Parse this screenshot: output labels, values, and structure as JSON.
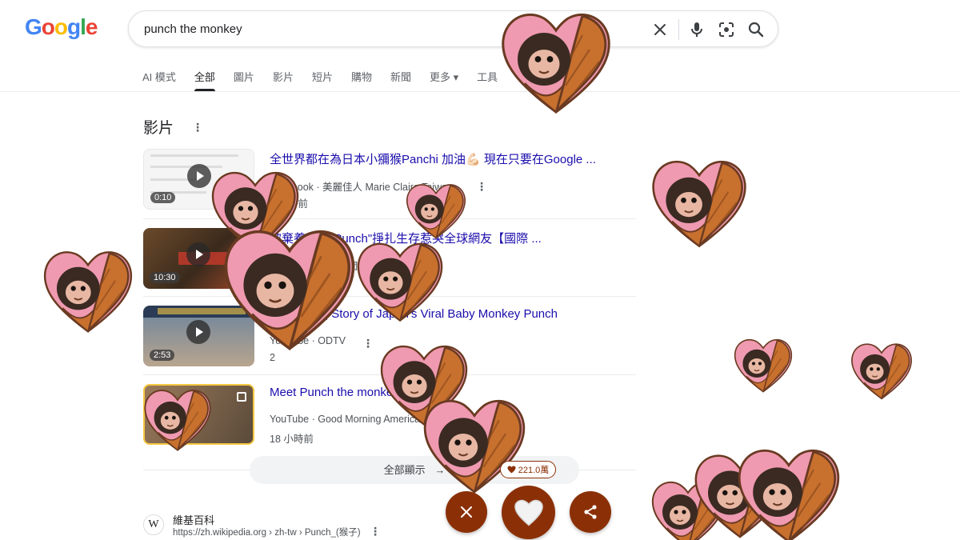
{
  "logo": {
    "letters": [
      "G",
      "o",
      "o",
      "g",
      "l",
      "e"
    ],
    "colors": [
      "#4285F4",
      "#EA4335",
      "#FBBC05",
      "#4285F4",
      "#34A853",
      "#EA4335"
    ]
  },
  "search": {
    "query": "punch the monkey",
    "icons": [
      "close-icon",
      "mic-icon",
      "lens-icon",
      "search-icon"
    ]
  },
  "tabs": [
    {
      "label": "AI 模式",
      "active": false
    },
    {
      "label": "全部",
      "active": true
    },
    {
      "label": "圖片",
      "active": false
    },
    {
      "label": "影片",
      "active": false
    },
    {
      "label": "短片",
      "active": false
    },
    {
      "label": "購物",
      "active": false
    },
    {
      "label": "新聞",
      "active": false
    },
    {
      "label": "更多 ▾",
      "active": false
    },
    {
      "label": "工具",
      "active": false
    }
  ],
  "videos_section": {
    "title": "影片",
    "items": [
      {
        "title": "全世界都在為日本小獼猴Panchi 加油💪🏻 現在只要在Google ...",
        "meta": "Facebook · 美麗佳人 Marie Claire Taiwan",
        "time": "9 小時前",
        "duration": "0:10"
      },
      {
        "title": "被棄養小猴\"Punch\"掙扎生存惹哭全球網友【國際 ...",
        "meta": "YouTube · 三立新聞",
        "time": "",
        "duration": "10:30"
      },
      {
        "title": "The Story | Story of Japan's Viral Baby Monkey Punch",
        "meta": "YouTube · ODTV",
        "time": "2",
        "duration": "2:53"
      },
      {
        "title": "Meet Punch the monkey",
        "meta": "YouTube · Good Morning America",
        "time": "18 小時前",
        "duration": ""
      }
    ],
    "show_all": "全部顯示"
  },
  "wiki": {
    "icon": "W",
    "site": "維基百科",
    "url": "https://zh.wikipedia.org › zh-tw › Punch_(猴子)"
  },
  "overlay": {
    "likes": "221.0萬",
    "accent": "#8b3006"
  }
}
